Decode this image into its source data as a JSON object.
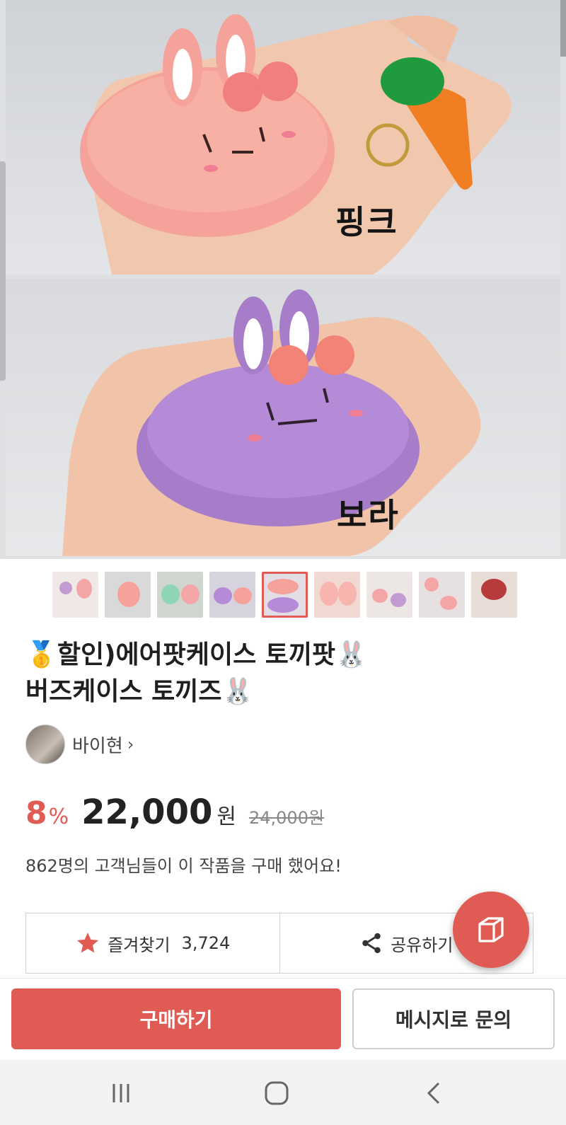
{
  "photos": {
    "top_label": "핑크",
    "bottom_label": "보라"
  },
  "thumbnails": {
    "count": 9,
    "active_index": 4
  },
  "product": {
    "title_line1": "할인)에어팟케이스 토끼팟",
    "title_line2": "버즈케이스 토끼즈",
    "medal_emoji": "🥇",
    "rabbit_emoji": "🐰"
  },
  "seller": {
    "name": "바이현"
  },
  "price": {
    "discount": "8",
    "percent_sign": "%",
    "sale": "22,000",
    "currency": "원",
    "original": "24,000원"
  },
  "buyers_text": "862명의 고객님들이 이 작품을 구매 했어요!",
  "actions": {
    "favorite_label": "즐겨찾기",
    "favorite_count": "3,724",
    "share_label": "공유하기"
  },
  "bottom_bar": {
    "buy_label": "구매하기",
    "message_label": "메시지로 문의"
  },
  "colors": {
    "accent": "#e05b53"
  }
}
